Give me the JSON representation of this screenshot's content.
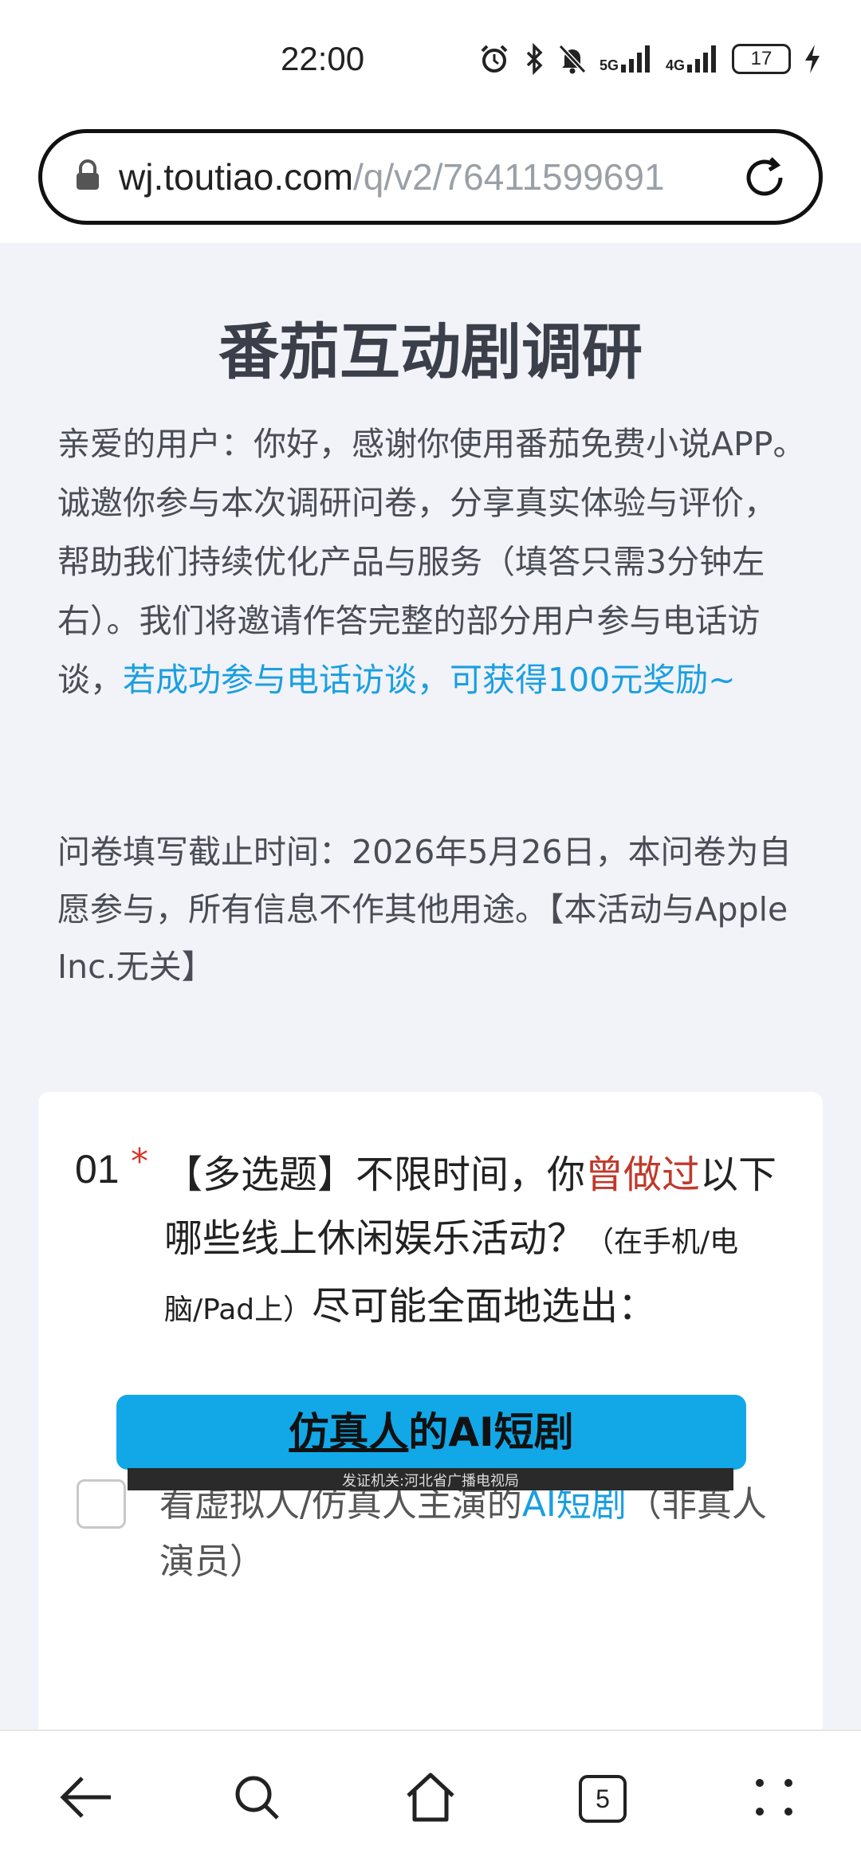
{
  "status_bar": {
    "time": "22:00",
    "network_1": "5G",
    "network_2": "4G",
    "battery": "17"
  },
  "browser": {
    "url_domain": "wj.toutiao.com",
    "url_path": "/q/v2/76411599691",
    "tab_count": "5"
  },
  "survey": {
    "title": "番茄互动剧调研",
    "intro_plain": "亲爱的用户：你好，感谢你使用番茄免费小说APP。诚邀你参与本次调研问卷，分享真实体验与评价，帮助我们持续优化产品与服务（填答只需3分钟左右）。我们将邀请作答完整的部分用户参与电话访谈，",
    "intro_highlight": "若成功参与电话访谈，可获得100元奖励~",
    "deadline": "问卷填写截止时间：2026年5月26日，本问卷为自愿参与，所有信息不作其他用途。【本活动与Apple Inc.无关】"
  },
  "question": {
    "number": "01",
    "required_mark": "*",
    "text_part1": "【多选题】不限时间，你",
    "text_red": "曾做过",
    "text_part2": "以下哪些线上休闲娱乐活动？",
    "text_small": "（在手机/电脑/Pad上）",
    "text_part3": "尽可能全面地选出："
  },
  "option": {
    "text_part1": "看虚拟人/仿真人主演的",
    "text_blue": "AI短剧",
    "text_part2": "（非真人演员）"
  },
  "banner": {
    "text_underlined": "仿真人",
    "text_rest": "的AI短剧",
    "video_caption": "发证机关:河北省广播电视局"
  },
  "colors": {
    "accent_blue": "#1a9fe0",
    "required_red": "#d9352b",
    "page_bg": "#f1f3f8",
    "banner_bg": "#12a8e8"
  },
  "icons": [
    "lock-icon",
    "reload-icon",
    "alarm-icon",
    "bluetooth-icon",
    "mute-icon",
    "signal-icon",
    "charging-icon",
    "back-arrow-icon",
    "search-icon",
    "home-icon",
    "tabs-icon",
    "menu-dots-icon"
  ]
}
